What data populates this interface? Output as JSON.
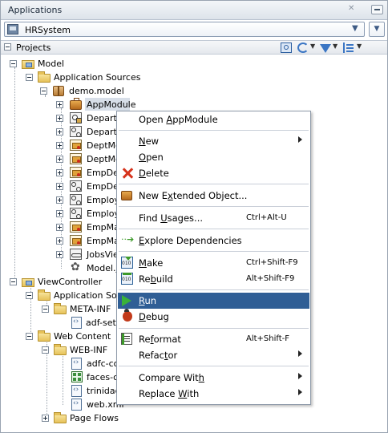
{
  "applications_panel": {
    "title": "Applications",
    "close_glyph": "✕",
    "application_name": "HRSystem"
  },
  "projects_panel": {
    "title": "Projects"
  },
  "tree": {
    "model": "Model",
    "application_sources": "Application Sources",
    "demo_model": "demo.model",
    "nodes": [
      {
        "label": "AppModule",
        "icon": "application-module-icon"
      },
      {
        "label": "Departm",
        "icon": "entity-object-icon"
      },
      {
        "label": "Departm",
        "icon": "association-icon"
      },
      {
        "label": "DeptMg",
        "icon": "view-object-icon"
      },
      {
        "label": "DeptMg",
        "icon": "view-object-icon"
      },
      {
        "label": "EmpDep",
        "icon": "view-object-icon"
      },
      {
        "label": "EmpDep",
        "icon": "association-icon"
      },
      {
        "label": "Employe",
        "icon": "association-icon"
      },
      {
        "label": "Employe",
        "icon": "association-icon"
      },
      {
        "label": "EmpMan",
        "icon": "view-object-icon"
      },
      {
        "label": "EmpMan",
        "icon": "view-object-icon"
      },
      {
        "label": "JobsView",
        "icon": "view-link-icon"
      },
      {
        "label": "Model.jp",
        "icon": "project-file-icon"
      }
    ],
    "view_controller": "ViewController",
    "vc_application_sources": "Application Sour",
    "meta_inf": "META-INF",
    "adf_settings": "adf-sett",
    "web_content": "Web Content",
    "web_inf": "WEB-INF",
    "web_inf_files": [
      {
        "label": "adfc-con",
        "icon": "xml-file-icon"
      },
      {
        "label": "faces-co",
        "icon": "faces-config-icon"
      },
      {
        "label": "trinidad",
        "icon": "xml-file-icon"
      },
      {
        "label": "web.xml",
        "icon": "xml-file-icon"
      }
    ],
    "page_flows": "Page Flows"
  },
  "context_menu": {
    "open_appmodule": {
      "pre": "Open ",
      "u": "A",
      "post": "ppModule"
    },
    "new": {
      "pre": "",
      "u": "N",
      "post": "ew"
    },
    "open": {
      "pre": "",
      "u": "O",
      "post": "pen"
    },
    "delete": {
      "pre": "",
      "u": "D",
      "post": "elete"
    },
    "new_extended": {
      "pre": "New E",
      "u": "x",
      "post": "tended Object..."
    },
    "find_usages": {
      "pre": "Find ",
      "u": "U",
      "post": "sages...",
      "shortcut": "Ctrl+Alt-U"
    },
    "explore": {
      "pre": "",
      "u": "E",
      "post": "xplore Dependencies"
    },
    "make": {
      "pre": "",
      "u": "M",
      "post": "ake",
      "shortcut": "Ctrl+Shift-F9"
    },
    "rebuild": {
      "pre": "Re",
      "u": "b",
      "post": "uild",
      "shortcut": "Alt+Shift-F9"
    },
    "run": {
      "pre": "",
      "u": "R",
      "post": "un"
    },
    "debug": {
      "pre": "",
      "u": "D",
      "post": "ebug"
    },
    "reformat": {
      "pre": "Re",
      "u": "f",
      "post": "ormat",
      "shortcut": "Alt+Shift-F"
    },
    "refactor": {
      "pre": "Refac",
      "u": "t",
      "post": "or"
    },
    "compare_with": {
      "pre": "Compare Wit",
      "u": "h",
      "post": ""
    },
    "replace_with": {
      "pre": "Replace ",
      "u": "W",
      "post": "ith"
    }
  },
  "colors": {
    "selection": "#2f5e95",
    "panel_header": "#dde3ea"
  }
}
